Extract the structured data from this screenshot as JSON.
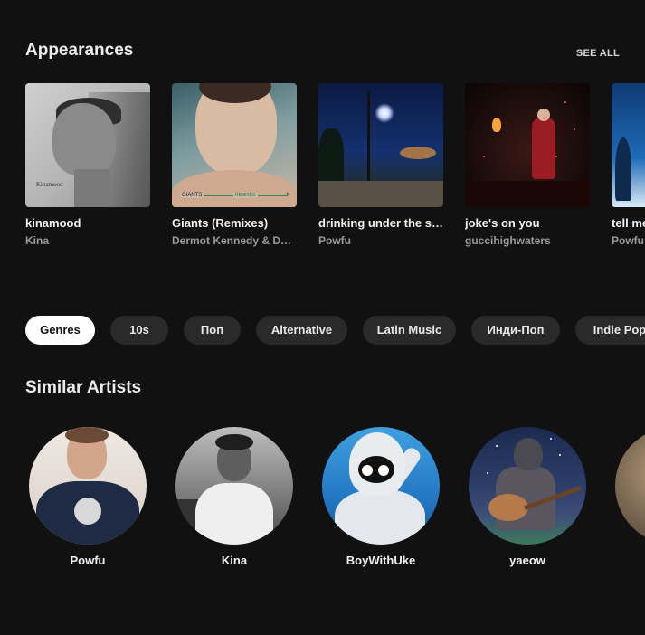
{
  "appearances": {
    "title": "Appearances",
    "see_all_label": "SEE ALL",
    "albums": [
      {
        "title": "kinamood",
        "artist": "Kina",
        "cover_text": "Kinamood"
      },
      {
        "title": "Giants (Remixes)",
        "artist": "Dermot Kennedy & David Guetta",
        "cover_text": "GIANTS",
        "cover_text_2": "REMIXES",
        "cover_text_3": "d̶"
      },
      {
        "title": "drinking under the streetlight",
        "artist": "Powfu"
      },
      {
        "title": "joke's on you",
        "artist": "guccihighwaters"
      },
      {
        "title": "tell me",
        "artist": "Powfu"
      }
    ]
  },
  "genres": {
    "items": [
      "Genres",
      "10s",
      "Поп",
      "Alternative",
      "Latin Music",
      "Инди-Поп",
      "Indie Pop"
    ],
    "active_index": 0
  },
  "similar_artists": {
    "title": "Similar Artists",
    "artists": [
      {
        "name": "Powfu"
      },
      {
        "name": "Kina"
      },
      {
        "name": "BoyWithUke"
      },
      {
        "name": "yaeow"
      },
      {
        "name": ""
      }
    ]
  },
  "colors": {
    "background": "#111111",
    "chip_background": "#2a2a2a",
    "chip_active_background": "#ffffff",
    "secondary_text": "#9a9a9a"
  }
}
